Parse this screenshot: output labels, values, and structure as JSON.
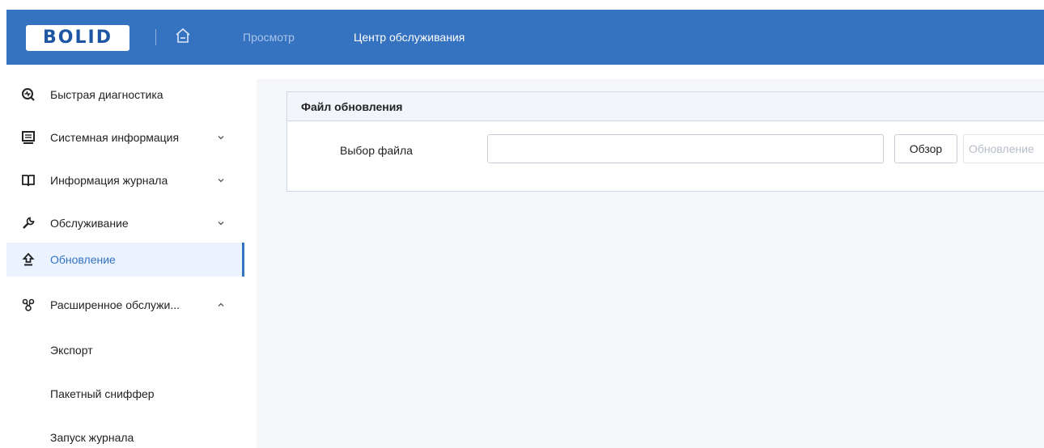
{
  "header": {
    "logo_text": "BOLID",
    "nav": {
      "view_label": "Просмотр",
      "service_center_label": "Центр обслуживания"
    }
  },
  "sidebar": {
    "items": [
      {
        "label": "Быстрая диагностика",
        "icon": "diagnostics-icon"
      },
      {
        "label": "Системная информация",
        "icon": "monitor-icon",
        "expand": "chevron-down"
      },
      {
        "label": "Информация журнала",
        "icon": "book-icon",
        "expand": "chevron-down"
      },
      {
        "label": "Обслуживание",
        "icon": "wrench-icon",
        "expand": "chevron-down"
      },
      {
        "label": "Обновление",
        "icon": "upload-arrow-icon",
        "active": true
      },
      {
        "label": "Расширенное обслужи...",
        "icon": "advanced-maintenance-icon",
        "expand": "chevron-up"
      }
    ],
    "sub_items": [
      {
        "label": "Экспорт"
      },
      {
        "label": "Пакетный сниффер"
      },
      {
        "label": "Запуск журнала"
      }
    ]
  },
  "update_panel": {
    "title": "Файл обновления",
    "file_label": "Выбор файла",
    "file_value": "",
    "browse_label": "Обзор",
    "update_label": "Обновление"
  },
  "colors": {
    "header_bg": "#3572c0",
    "active_item_bg": "#eaf3ff",
    "accent": "#3572c0",
    "content_bg": "#f4f6fa"
  }
}
